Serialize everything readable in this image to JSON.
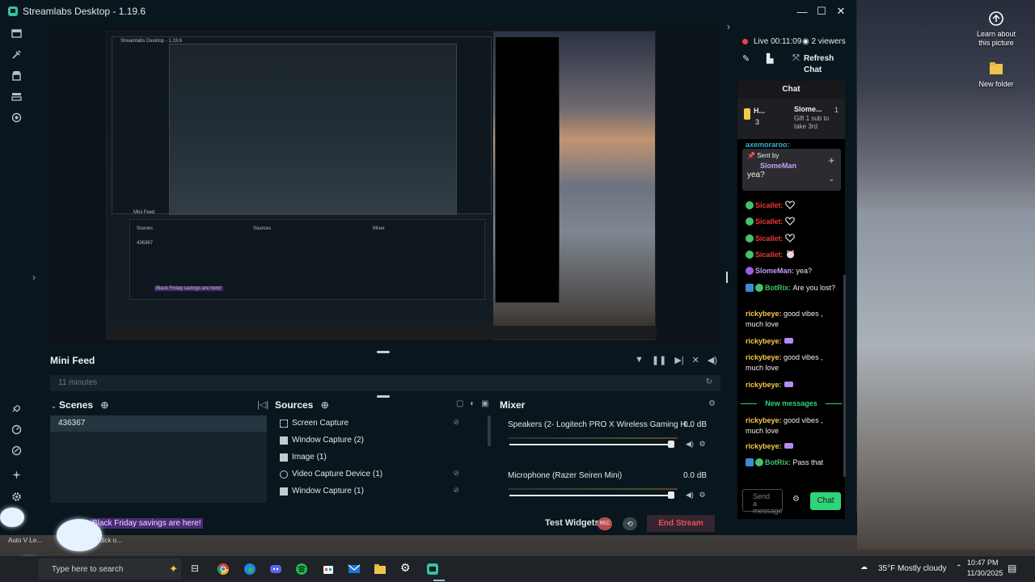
{
  "window": {
    "title": "Streamlabs Desktop - 1.19.6",
    "controls": [
      "minimize",
      "maximize",
      "close"
    ]
  },
  "desktop": {
    "icons": [
      {
        "label": "Learn about this picture",
        "icon": "learn-about-picture-icon"
      },
      {
        "label": "New folder",
        "icon": "folder-icon"
      }
    ]
  },
  "left_nav": {
    "icons": [
      "editor-icon",
      "themes-icon",
      "store-icon",
      "layout-icon",
      "highlighter-icon",
      "integrations-icon",
      "dashboard-icon",
      "grow-icon",
      "apps-icon",
      "settings-icon"
    ]
  },
  "preview": {
    "nested_title": "Streamlabs Desktop - 1.19.6",
    "nested_minifeed": "Mini Feed",
    "nested_scenes": "Scenes",
    "nested_sources": "Sources",
    "nested_mixer": "Mixer",
    "nested_scene_row": "436367",
    "nested_promo": "Black Friday savings are here!"
  },
  "minifeed": {
    "title": "Mini Feed",
    "time": "11 minutes"
  },
  "scenes": {
    "title": "Scenes",
    "items": [
      "436367"
    ]
  },
  "sources": {
    "title": "Sources",
    "items": [
      {
        "label": "Screen Capture",
        "icon": "monitor-icon"
      },
      {
        "label": "Window Capture (2)",
        "icon": "window-icon"
      },
      {
        "label": "Image (1)",
        "icon": "image-icon"
      },
      {
        "label": "Video Capture Device (1)",
        "icon": "camera-icon"
      },
      {
        "label": "Window Capture (1)",
        "icon": "window-icon"
      }
    ]
  },
  "mixer": {
    "title": "Mixer",
    "items": [
      {
        "name": "Speakers (2- Logitech PRO X Wireless Gaming H...",
        "db": "0.0 dB",
        "level": 0.95
      },
      {
        "name": "Microphone (Razer Seiren Mini)",
        "db": "0.0 dB",
        "level": 0.95
      }
    ]
  },
  "footer": {
    "promo": "Black Friday savings are here!",
    "test_widgets": "Test Widgets",
    "rec": "REC",
    "end_stream": "End Stream",
    "bottom_left_1": "Auto V Le...",
    "bottom_left_2": "Stick o..."
  },
  "stream_status": {
    "live": "Live 00:11:09",
    "viewers": "2 viewers",
    "refresh": "Refresh Chat"
  },
  "chat": {
    "title": "Chat",
    "hype_train": {
      "tag": "H...",
      "level": "3",
      "user": "Slome...",
      "count": "1",
      "message": "Gift 1 sub to take 3rd"
    },
    "pinned": {
      "label": "Sent by",
      "user": "SlomeMan",
      "text": "yea?"
    },
    "partial_user": "axemoraroo:",
    "messages": [
      {
        "user": "Sicallet:",
        "text": "",
        "color": "#e83b3b",
        "emote": "heart"
      },
      {
        "user": "Sicallet:",
        "text": "",
        "color": "#e83b3b",
        "emote": "heart"
      },
      {
        "user": "Sicallet:",
        "text": "",
        "color": "#e83b3b",
        "emote": "heart"
      },
      {
        "user": "Sicallet:",
        "text": "",
        "color": "#e83b3b",
        "emote": "cat"
      },
      {
        "user": "SlomeMan:",
        "text": "yea?",
        "color": "#c5a0f5"
      },
      {
        "user": "BotRix:",
        "text": "Are you lost?",
        "color": "#45c16b"
      },
      {
        "user": "rickybeye:",
        "text": "good vibes , much love",
        "color": "#f5c94a"
      },
      {
        "user": "rickybeye:",
        "text": "",
        "color": "#f5c94a",
        "emote": "lurk"
      },
      {
        "user": "rickybeye:",
        "text": "good vibes , much love",
        "color": "#f5c94a"
      },
      {
        "user": "rickybeye:",
        "text": "",
        "color": "#f5c94a",
        "emote": "lurk"
      }
    ],
    "new_messages": "New messages",
    "messages_after": [
      {
        "user": "rickybeye:",
        "text": "good vibes , much love",
        "color": "#f5c94a"
      },
      {
        "user": "rickybeye:",
        "text": "",
        "color": "#f5c94a",
        "emote": "lurk"
      },
      {
        "user": "BotRix:",
        "text": "Pass that",
        "color": "#45c16b"
      }
    ],
    "input_placeholder": "Send a message",
    "send_label": "Chat"
  },
  "taskbar": {
    "search_placeholder": "Type here to search",
    "weather": "35°F  Mostly cloudy",
    "time": "10:47 PM",
    "date": "11/30/2025"
  }
}
